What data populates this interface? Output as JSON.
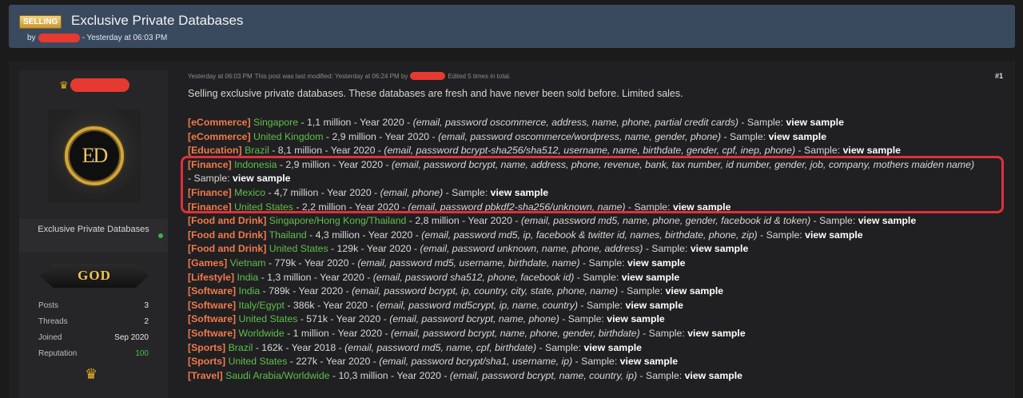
{
  "thread": {
    "prefix": "SELLING",
    "title": "Exclusive Private Databases",
    "by": "by",
    "posted": "- Yesterday at 06:03 PM"
  },
  "user": {
    "avatar_text": "ED",
    "custom_title": "Exclusive Private Databases",
    "rank": "GOD",
    "stats": [
      {
        "label": "Posts",
        "value": "3"
      },
      {
        "label": "Threads",
        "value": "2"
      },
      {
        "label": "Joined",
        "value": "Sep 2020"
      },
      {
        "label": "Reputation",
        "value": "100"
      }
    ]
  },
  "post": {
    "meta_time": "Yesterday at 06:03 PM",
    "meta_modified": "This post was last modified: Yesterday at 06:24 PM by",
    "meta_edited": "Edited 5 times in total.",
    "number": "#1",
    "intro": "Selling exclusive private databases. These databases are fresh and have never been sold before. Limited sales.",
    "view_label": "view sample",
    "items": [
      {
        "category": "[eCommerce]",
        "country": "Singapore",
        "details": " - 1,1 million - Year 2020 - ",
        "fields": "(email, password oscommerce, address, name, phone, partial credit cards)",
        "sample": " - Sample: "
      },
      {
        "category": "[eCommerce]",
        "country": "United Kingdom",
        "details": " - 2,9 million - Year 2020 - ",
        "fields": "(email, password oscommerce/wordpress, name, gender, phone)",
        "sample": " - Sample: "
      },
      {
        "category": "[Education]",
        "country": "Brazil",
        "details": " - 8,1 million - Year 2020 - ",
        "fields": "(email, password bcrypt-sha256/sha512, username, name, birthdate, gender, cpf, inep, phone)",
        "sample": " - Sample: "
      },
      {
        "category": "[Finance]",
        "country": "Indonesia",
        "details": " - 2,9 million - Year 2020 - ",
        "fields": "(email, password bcrypt, name, address, phone, revenue, bank, tax number, id number, gender, job, company, mothers maiden name)",
        "sample": " - Sample: ",
        "wrap": true
      },
      {
        "category": "[Finance]",
        "country": "Mexico",
        "details": " - 4,7 million - Year 2020 - ",
        "fields": "(email, phone)",
        "sample": " - Sample: "
      },
      {
        "category": "[Finance]",
        "country": "United States",
        "details": " - 2,2 million - Year 2020 - ",
        "fields": "(email, password pbkdf2-sha256/unknown, name)",
        "sample": " - Sample: "
      },
      {
        "category": "[Food and Drink]",
        "country": "Singapore/Hong Kong/Thailand",
        "details": " - 2,8 million - Year 2020 - ",
        "fields": "(email, password md5, name, phone, gender, facebook id & token)",
        "sample": " - Sample: "
      },
      {
        "category": "[Food and Drink]",
        "country": "Thailand",
        "details": " - 4,3 million - Year 2020 - ",
        "fields": "(email, password md5, ip, facebook & twitter id, names, birthdate, phone, zip)",
        "sample": " - Sample: "
      },
      {
        "category": "[Food and Drink]",
        "country": "United States",
        "details": " - 129k - Year 2020 - ",
        "fields": "(email, password unknown, name, phone, address)",
        "sample": " - Sample: "
      },
      {
        "category": "[Games]",
        "country": "Vietnam",
        "details": " - 779k - Year 2020 - ",
        "fields": "(email, password md5, username, birthdate, name)",
        "sample": " - Sample: "
      },
      {
        "category": "[Lifestyle]",
        "country": "India",
        "details": " - 1,3 million - Year 2020 - ",
        "fields": "(email, password sha512, phone, facebook id)",
        "sample": " - Sample: "
      },
      {
        "category": "[Software]",
        "country": "India",
        "details": " - 789k - Year 2020 - ",
        "fields": "(email, password bcrypt, ip, country, city, state, phone, name)",
        "sample": " - Sample: "
      },
      {
        "category": "[Software]",
        "country": "Italy/Egypt",
        "details": " - 386k - Year 2020 - ",
        "fields": "(email, password md5crypt, ip, name, country)",
        "sample": " - Sample: "
      },
      {
        "category": "[Software]",
        "country": "United States",
        "details": " - 571k - Year 2020 - ",
        "fields": "(email, password bcrypt, name, phone)",
        "sample": " - Sample: "
      },
      {
        "category": "[Software]",
        "country": "Worldwide",
        "details": " - 1 million - Year 2020 - ",
        "fields": "(email, password bcrypt, name, phone, gender, birthdate)",
        "sample": " - Sample: "
      },
      {
        "category": "[Sports]",
        "country": "Brazil",
        "details": " - 162k - Year 2018 - ",
        "fields": "(email, password md5, name, cpf, birthdate)",
        "sample": " - Sample: "
      },
      {
        "category": "[Sports]",
        "country": "United States",
        "details": " - 227k - Year 2020 - ",
        "fields": "(email, password bcrypt/sha1, username, ip)",
        "sample": " - Sample: "
      },
      {
        "category": "[Travel]",
        "country": "Saudi Arabia/Worldwide",
        "details": " - 10,3 million - Year 2020 - ",
        "fields": "(email, password bcrypt, name, country, ip)",
        "sample": " - Sample: "
      }
    ]
  },
  "colors": {
    "category": "#f07a4a",
    "country": "#5fbf4b",
    "highlight_box": "#e0303a",
    "redaction": "#e63a30"
  }
}
